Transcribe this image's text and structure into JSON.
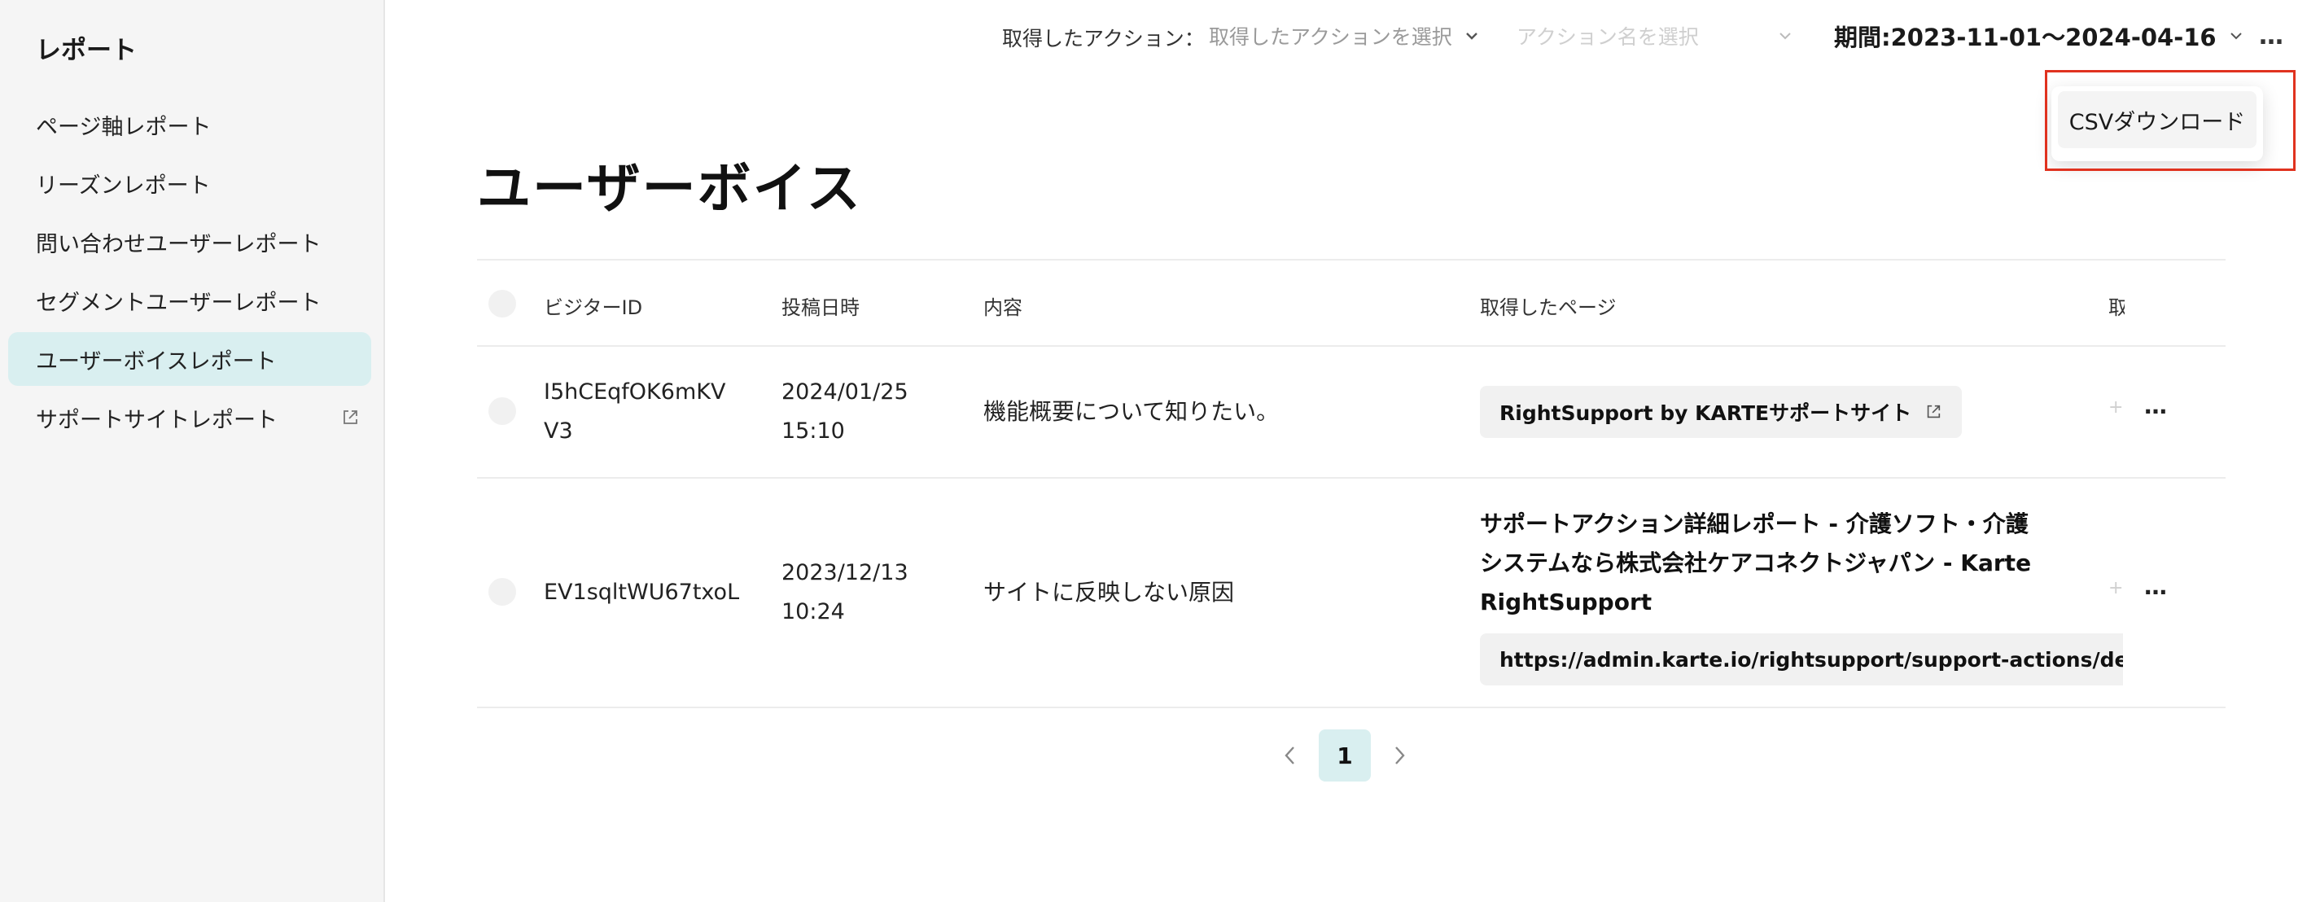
{
  "sidebar": {
    "title": "レポート",
    "items": [
      {
        "label": "ページ軸レポート"
      },
      {
        "label": "リーズンレポート"
      },
      {
        "label": "問い合わせユーザーレポート"
      },
      {
        "label": "セグメントユーザーレポート"
      },
      {
        "label": "ユーザーボイスレポート",
        "active": true
      },
      {
        "label": "サポートサイトレポート",
        "external": true
      }
    ]
  },
  "topbar": {
    "action_filter_label": "取得したアクション：",
    "action_select_placeholder": "取得したアクションを選択",
    "action_name_placeholder": "アクション名を選択",
    "period_label": "期間: ",
    "period_value": "2023-11-01〜2024-04-16",
    "more_label": "…"
  },
  "menu": {
    "csv_download": "CSVダウンロード"
  },
  "page": {
    "title": "ユーザーボイス"
  },
  "table": {
    "headers": {
      "visitor_id": "ビジターID",
      "posted_at": "投稿日時",
      "content": "内容",
      "page": "取得したページ",
      "action": "取"
    },
    "rows": [
      {
        "visitor_id": "I5hCEqfOK6mKVV3",
        "posted_at": "2024/01/25 15:10",
        "content": "機能概要について知りたい。",
        "page_chip": "RightSupport by KARTEサポートサイト",
        "more": "…"
      },
      {
        "visitor_id": "EV1sqltWU67txoL",
        "posted_at": "2023/12/13 10:24",
        "content": "サイトに反映しない原因",
        "page_title": "サポートアクション詳細レポート - 介護ソフト・介護システムなら株式会社ケアコネクトジャパン - Karte RightSupport",
        "page_url": "https://admin.karte.io/rightsupport/support-actions/detail/repo",
        "more": "…"
      }
    ]
  },
  "pagination": {
    "current": "1"
  },
  "colors": {
    "accent_bg": "#d9eff0",
    "highlight": "#e0321f",
    "sidebar_bg": "#f5f5f5"
  }
}
